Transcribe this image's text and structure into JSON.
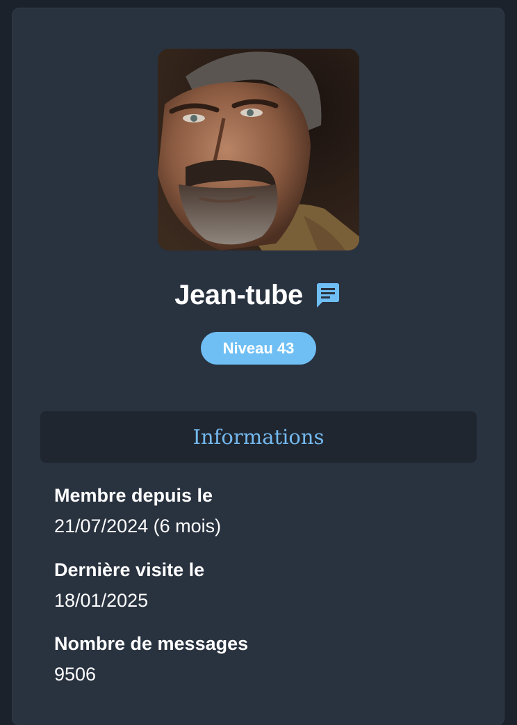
{
  "profile": {
    "username": "Jean-tube",
    "level_badge": "Niveau 43",
    "message_icon": "chat-icon",
    "accent_color": "#6fbff5"
  },
  "info_section": {
    "title": "Informations",
    "items": [
      {
        "label": "Membre depuis le",
        "value": "21/07/2024 (6 mois)"
      },
      {
        "label": "Dernière visite le",
        "value": "18/01/2025"
      },
      {
        "label": "Nombre de messages",
        "value": "9506"
      }
    ]
  }
}
